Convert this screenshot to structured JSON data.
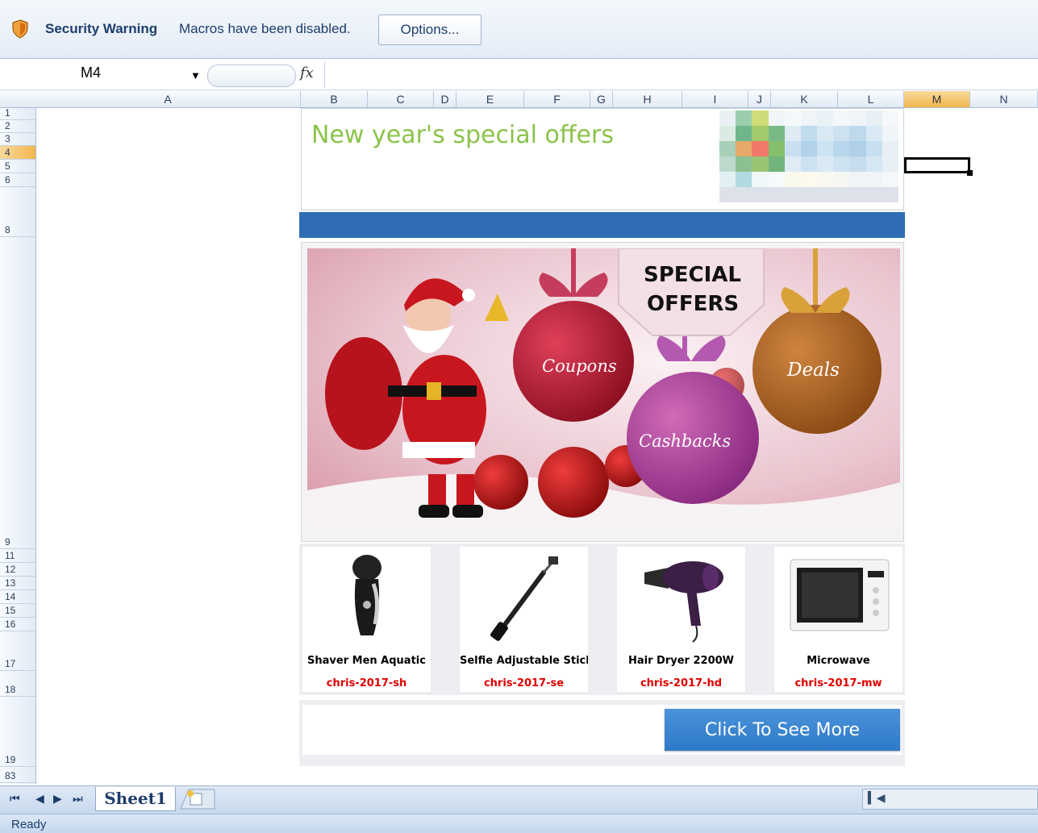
{
  "security_bar": {
    "title": "Security Warning",
    "message": "Macros have been disabled.",
    "options_label": "Options..."
  },
  "formula_bar": {
    "name_box": "M4",
    "fx_label": "fx",
    "formula": ""
  },
  "columns": [
    "A",
    "B",
    "C",
    "D",
    "E",
    "F",
    "G",
    "H",
    "I",
    "J",
    "K",
    "L",
    "M",
    "N"
  ],
  "selected_column": "M",
  "rows": [
    "1",
    "2",
    "3",
    "4",
    "5",
    "6",
    "8",
    "9",
    "11",
    "12",
    "13",
    "14",
    "15",
    "16",
    "17",
    "18",
    "19",
    "83"
  ],
  "selected_row": "4",
  "sheet": {
    "title": "New year's special offers",
    "banner": {
      "headline_line1": "SPECIAL",
      "headline_line2": "OFFERS",
      "ornament_coupons": "Coupons",
      "ornament_cashbacks": "Cashbacks",
      "ornament_deals": "Deals"
    },
    "products": [
      {
        "name": "Shaver Men Aquatic",
        "code": "chris-2017-sh",
        "icon": "shaver-icon"
      },
      {
        "name": "Selfie Adjustable Stick",
        "code": "chris-2017-se",
        "icon": "selfie-stick-icon"
      },
      {
        "name": "Hair Dryer 2200W",
        "code": "chris-2017-hd",
        "icon": "hair-dryer-icon"
      },
      {
        "name": "Microwave",
        "code": "chris-2017-mw",
        "icon": "microwave-icon"
      }
    ],
    "cta_label": "Click To See More"
  },
  "tabs": {
    "sheets": [
      "Sheet1"
    ]
  },
  "status": {
    "text": "Ready"
  },
  "colors": {
    "title_green": "#8bc34a",
    "bar_blue": "#2e6db4",
    "code_red": "#e00000",
    "cta_blue": "#3a86d1"
  }
}
